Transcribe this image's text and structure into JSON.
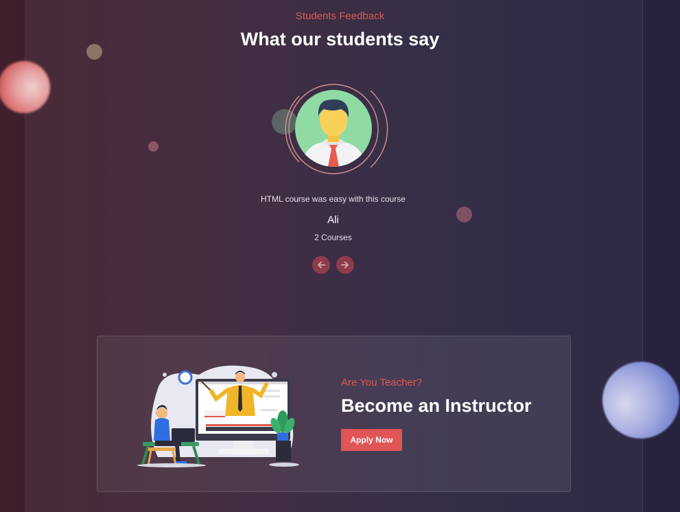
{
  "testimonials": {
    "eyebrow": "Students Feedback",
    "heading": "What our students say",
    "active": {
      "quote": "HTML course was easy with this course",
      "name": "Ali",
      "courses": "2 Courses"
    },
    "nav": {
      "prev_icon": "arrow-left-icon",
      "next_icon": "arrow-right-icon"
    }
  },
  "instructor_cta": {
    "eyebrow": "Are You Teacher?",
    "heading": "Become an Instructor",
    "button_label": "Apply Now",
    "illustration": "online-teacher-illustration"
  },
  "colors": {
    "accent": "#e25555",
    "text": "#ffffff",
    "nav_button": "#8d3c4c"
  }
}
